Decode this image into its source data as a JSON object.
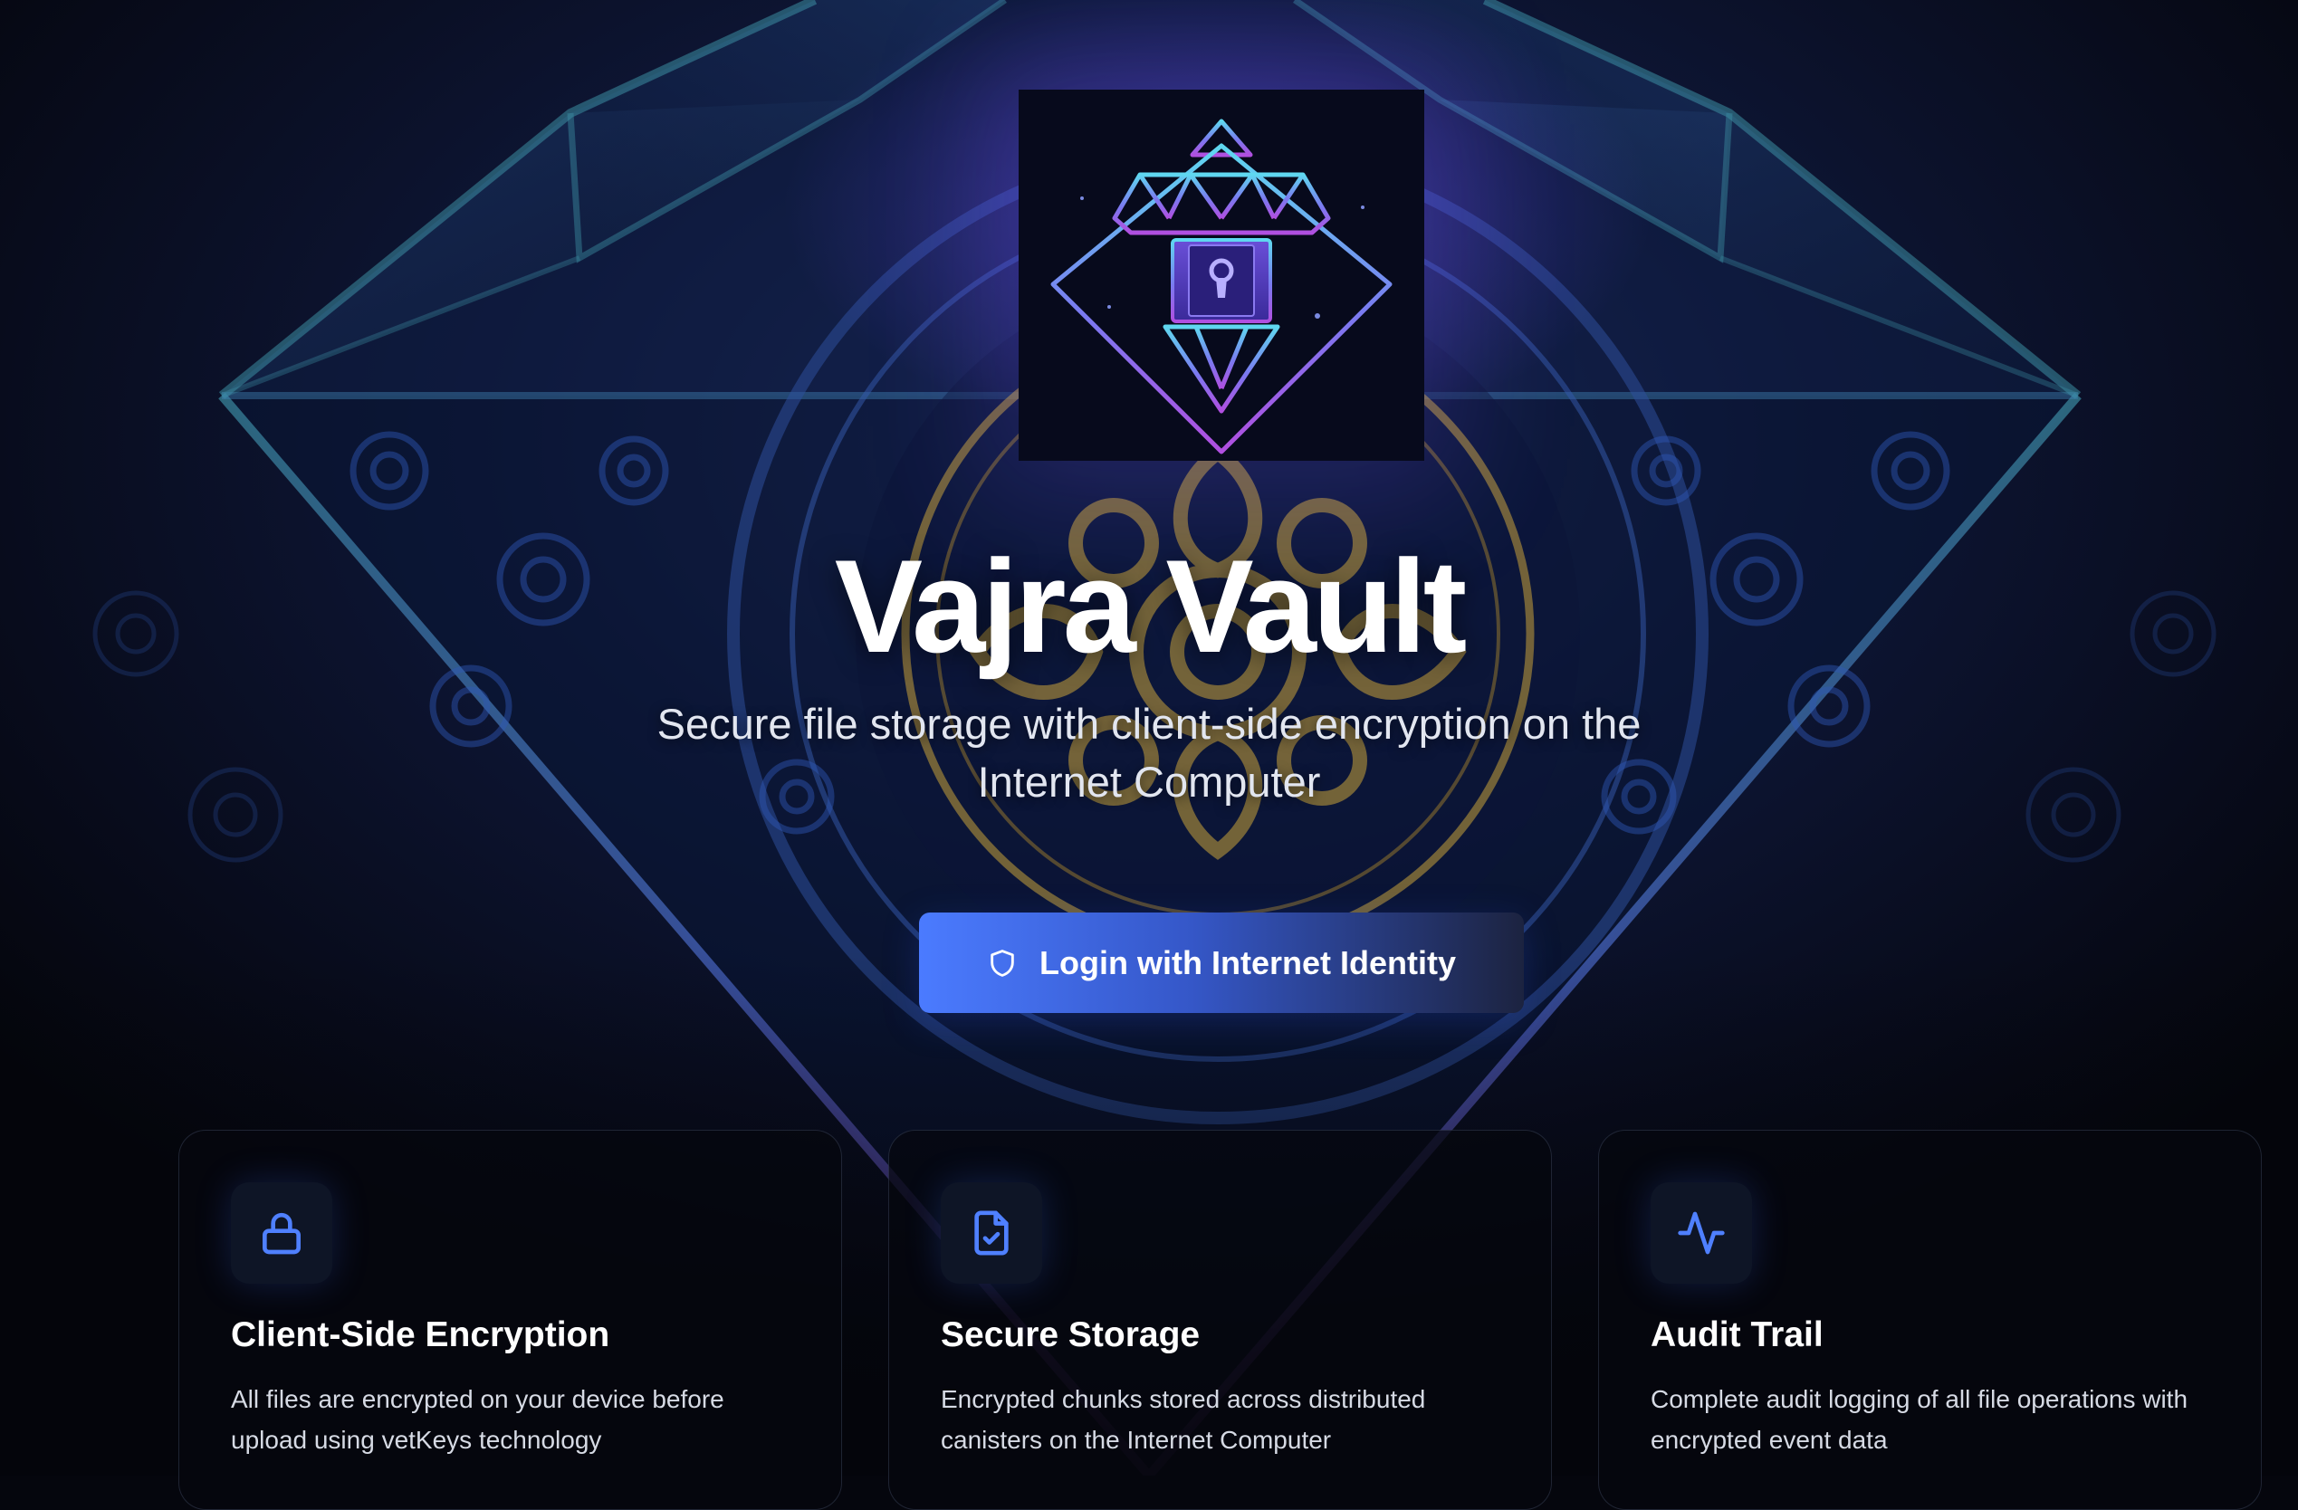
{
  "hero": {
    "title": "Vajra Vault",
    "subtitle": "Secure file storage with client-side encryption on the Internet Computer"
  },
  "login": {
    "label": "Login with Internet Identity",
    "icon": "shield-icon"
  },
  "features": [
    {
      "icon": "lock-icon",
      "title": "Client-Side Encryption",
      "description": "All files are encrypted on your device before upload using vetKeys technology"
    },
    {
      "icon": "file-check-icon",
      "title": "Secure Storage",
      "description": "Encrypted chunks stored across distributed canisters on the Internet Computer"
    },
    {
      "icon": "activity-icon",
      "title": "Audit Trail",
      "description": "Complete audit logging of all file operations with encrypted event data"
    }
  ],
  "colors": {
    "accent_blue": "#4b7bff",
    "logo_cyan": "#5fd8f0",
    "logo_purple": "#b04fe0",
    "ornament_gold": "#c9a33a",
    "background": "#05060d"
  }
}
